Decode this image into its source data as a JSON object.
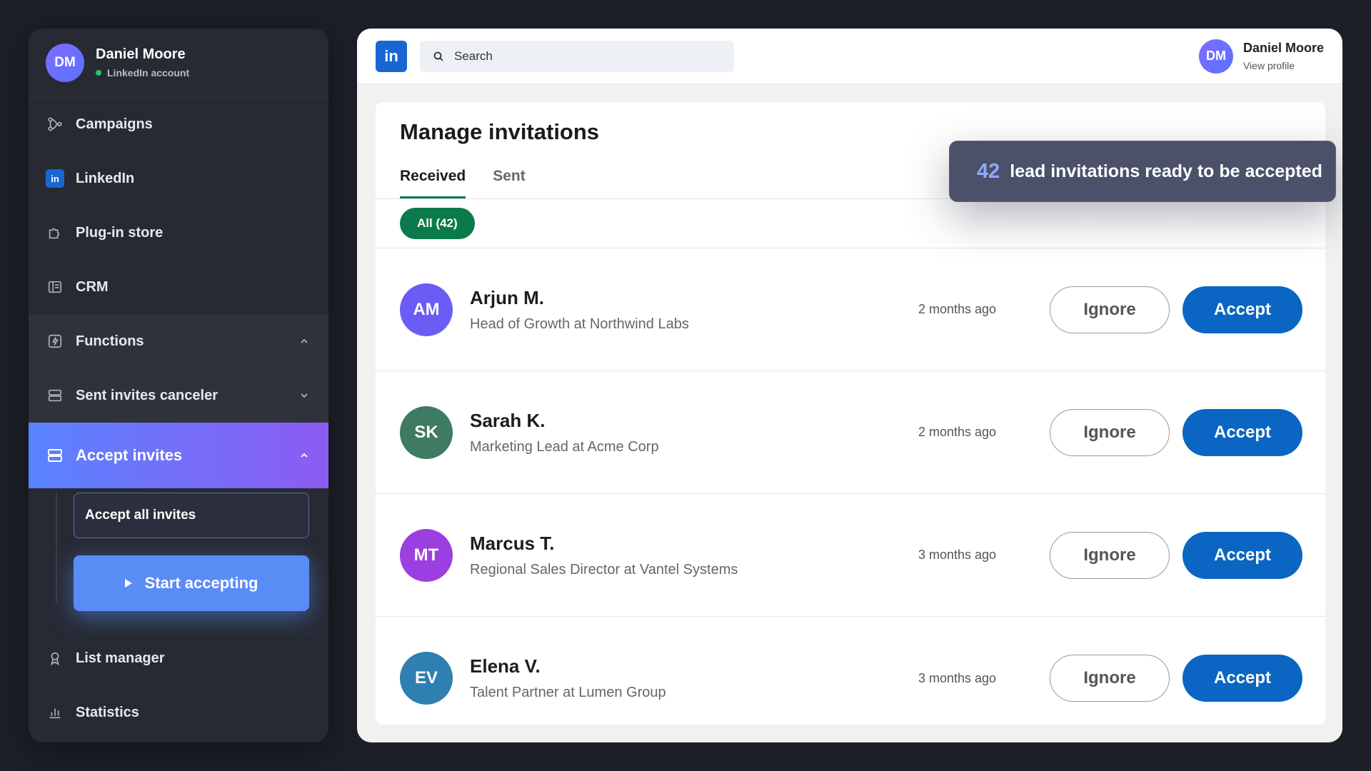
{
  "sidebar": {
    "profile": {
      "initials": "DM",
      "name": "Daniel Moore",
      "status": "LinkedIn account"
    },
    "items": {
      "campaigns": "Campaigns",
      "linkedin": "LinkedIn",
      "linkedin_badge": "in",
      "plugin_store": "Plug-in store",
      "crm": "CRM",
      "functions": "Functions",
      "sent_invites_canceler": "Sent invites canceler",
      "accept_invites": "Accept invites",
      "list_manager": "List manager",
      "statistics": "Statistics"
    },
    "submenu": {
      "accept_all": "Accept all invites",
      "start": "Start accepting"
    }
  },
  "topbar": {
    "logo": "in",
    "search_placeholder": "Search",
    "user": {
      "initials": "DM",
      "name": "Daniel Moore",
      "link": "View profile"
    }
  },
  "card": {
    "title": "Manage invitations",
    "tabs": [
      "Received",
      "Sent"
    ],
    "filter": "All (42)"
  },
  "toast": {
    "count": "42",
    "text": "lead invitations ready to be accepted"
  },
  "invitations": [
    {
      "initials": "AM",
      "name": "Arjun M.",
      "title": "Head of Growth at Northwind Labs",
      "time": "2 months ago",
      "color": "#6b5cf6"
    },
    {
      "initials": "SK",
      "name": "Sarah K.",
      "title": "Marketing Lead at Acme Corp",
      "time": "2 months ago",
      "color": "#3f7a63"
    },
    {
      "initials": "MT",
      "name": "Marcus T.",
      "title": "Regional Sales Director at Vantel Systems",
      "time": "3 months ago",
      "color": "#9b3fe0"
    },
    {
      "initials": "EV",
      "name": "Elena V.",
      "title": "Talent Partner at Lumen Group",
      "time": "3 months ago",
      "color": "#2f7fb0"
    }
  ],
  "buttons": {
    "ignore": "Ignore",
    "accept": "Accept"
  },
  "colors": {
    "accent_green": "#0a7a4b",
    "accept_blue": "#0a66c2",
    "sidebar_active_start": "#5a83ff",
    "sidebar_active_end": "#8c5bf2"
  }
}
